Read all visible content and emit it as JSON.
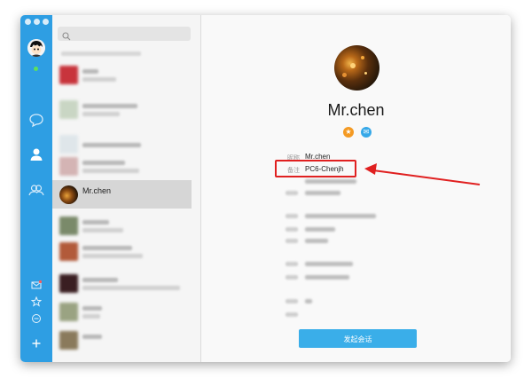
{
  "colors": {
    "rail": "#2e9ee3",
    "accent": "#3aaee9",
    "highlight": "#e02020"
  },
  "rail": {
    "icons": [
      "chat-bubble-icon",
      "contacts-icon",
      "groups-icon",
      "mail-icon",
      "star-icon",
      "minus-circle-icon",
      "plus-icon"
    ]
  },
  "search": {
    "placeholder": ""
  },
  "contacts": {
    "selected_name": "Mr.chen"
  },
  "profile": {
    "name": "Mr.chen",
    "nickname_label": "昵称",
    "nickname": "Mr.chen",
    "remark_label": "备注",
    "remark": "PC6-Chenjh",
    "start_chat_label": "发起会话"
  }
}
